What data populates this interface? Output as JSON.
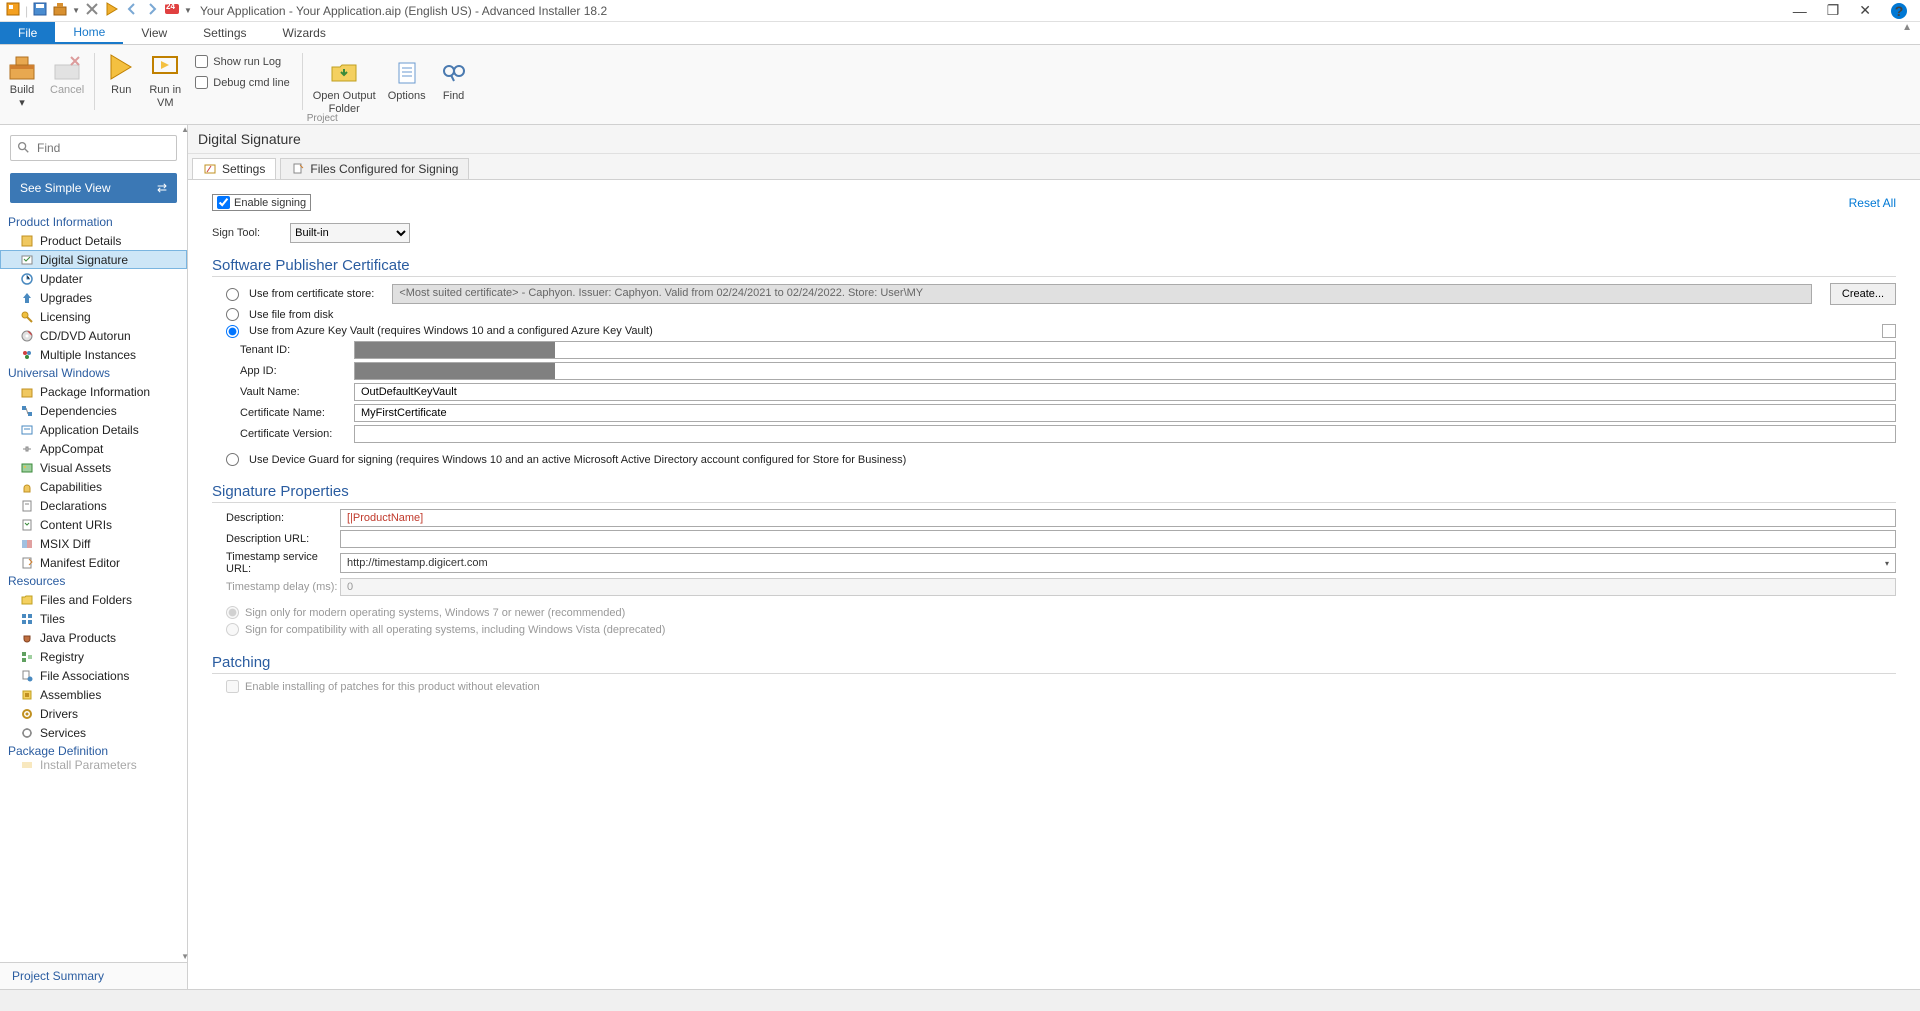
{
  "titlebar": {
    "title": "Your Application - Your Application.aip (English US) - Advanced Installer 18.2",
    "qat_badge": "24"
  },
  "menu": {
    "file": "File",
    "home": "Home",
    "view": "View",
    "settings": "Settings",
    "wizards": "Wizards"
  },
  "ribbon": {
    "build": "Build",
    "cancel": "Cancel",
    "run": "Run",
    "run_in_vm": "Run in\nVM",
    "show_run_log": "Show run Log",
    "debug_cmd": "Debug cmd line",
    "open_output": "Open Output\nFolder",
    "options": "Options",
    "find": "Find",
    "group_project": "Project"
  },
  "sidebar": {
    "search_placeholder": "Find",
    "simple_view": "See Simple View",
    "sections": {
      "product_info": "Product Information",
      "universal": "Universal Windows",
      "resources": "Resources",
      "package_def": "Package Definition"
    },
    "nodes": {
      "product_details": "Product Details",
      "digital_signature": "Digital Signature",
      "updater": "Updater",
      "upgrades": "Upgrades",
      "licensing": "Licensing",
      "cd_autorun": "CD/DVD Autorun",
      "multiple_instances": "Multiple Instances",
      "package_info": "Package Information",
      "dependencies": "Dependencies",
      "app_details": "Application Details",
      "appcompat": "AppCompat",
      "visual_assets": "Visual Assets",
      "capabilities": "Capabilities",
      "declarations": "Declarations",
      "content_uris": "Content URIs",
      "msix_diff": "MSIX Diff",
      "manifest_editor": "Manifest Editor",
      "files_folders": "Files and Folders",
      "tiles": "Tiles",
      "java_products": "Java Products",
      "registry": "Registry",
      "file_assoc": "File Associations",
      "assemblies": "Assemblies",
      "drivers": "Drivers",
      "services": "Services",
      "install_params": "Install Parameters"
    },
    "project_summary": "Project Summary"
  },
  "content": {
    "header": "Digital Signature",
    "tabs": {
      "settings": "Settings",
      "files": "Files Configured for Signing"
    },
    "enable_signing": "Enable signing",
    "reset_all": "Reset All",
    "sign_tool_label": "Sign Tool:",
    "sign_tool_value": "Built-in",
    "section_spc": "Software Publisher Certificate",
    "radio_cert_store": "Use from certificate store:",
    "radio_file_disk": "Use file from disk",
    "radio_azure": "Use from Azure Key Vault (requires Windows 10 and a configured Azure Key Vault)",
    "radio_device_guard": "Use Device Guard for signing (requires Windows 10 and an active Microsoft Active Directory account configured for Store for Business)",
    "cert_combo": "<Most suited certificate>  -  Caphyon. Issuer: Caphyon. Valid from 02/24/2021 to 02/24/2022. Store: User\\MY",
    "create_btn": "Create...",
    "tenant_id_label": "Tenant ID:",
    "app_id_label": "App ID:",
    "vault_name_label": "Vault Name:",
    "vault_name_value": "OutDefaultKeyVault",
    "cert_name_label": "Certificate Name:",
    "cert_name_value": "MyFirstCertificate",
    "cert_version_label": "Certificate Version:",
    "cert_version_value": "",
    "section_sig": "Signature Properties",
    "desc_label": "Description:",
    "desc_value": "[|ProductName]",
    "desc_url_label": "Description URL:",
    "desc_url_value": "",
    "timestamp_url_label": "Timestamp service URL:",
    "timestamp_url_value": "http://timestamp.digicert.com",
    "timestamp_delay_label": "Timestamp delay (ms):",
    "timestamp_delay_value": "0",
    "sign_modern": "Sign only for modern operating systems, Windows 7 or newer (recommended)",
    "sign_compat": "Sign for compatibility with all operating systems, including Windows Vista (deprecated)",
    "section_patching": "Patching",
    "patching_check": "Enable installing of patches for this product without elevation"
  }
}
